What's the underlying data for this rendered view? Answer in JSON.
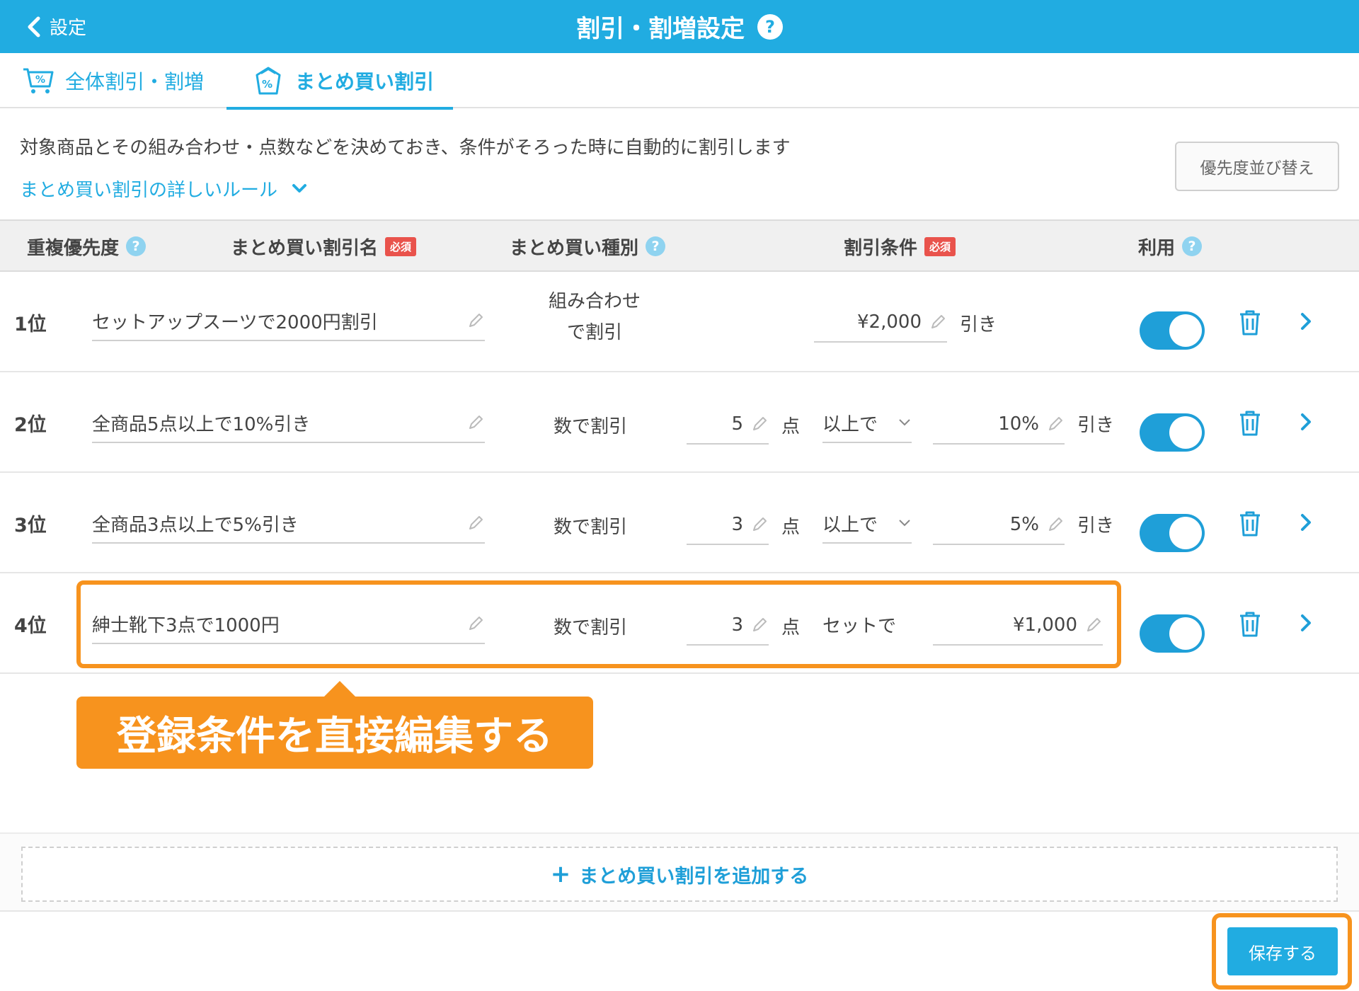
{
  "header": {
    "back_label": "設定",
    "title": "割引・割増設定",
    "help": "?"
  },
  "tabs": [
    {
      "label": "全体割引・割増"
    },
    {
      "label": "まとめ買い割引"
    }
  ],
  "description": "対象商品とその組み合わせ・点数などを決めておき、条件がそろった時に自動的に割引します",
  "rules_link": "まとめ買い割引の詳しいルール",
  "sort_button": "優先度並び替え",
  "columns": {
    "priority": "重複優先度",
    "name": "まとめ買い割引名",
    "type": "まとめ買い種別",
    "condition": "割引条件",
    "use": "利用",
    "required": "必須",
    "help": "?"
  },
  "rows": [
    {
      "rank": "1位",
      "name": "セットアップスーツで2000円割引",
      "type_line1": "組み合わせ",
      "type_line2": "で割引",
      "amount": "¥2,000",
      "suffix": "引き"
    },
    {
      "rank": "2位",
      "name": "全商品5点以上で10%引き",
      "type": "数で割引",
      "count": "5",
      "unit": "点",
      "operator": "以上で",
      "amount": "10%",
      "suffix": "引き"
    },
    {
      "rank": "3位",
      "name": "全商品3点以上で5%引き",
      "type": "数で割引",
      "count": "3",
      "unit": "点",
      "operator": "以上で",
      "amount": "5%",
      "suffix": "引き"
    },
    {
      "rank": "4位",
      "name": "紳士靴下3点で1000円",
      "type": "数で割引",
      "count": "3",
      "unit": "点",
      "operator": "セットで",
      "amount": "¥1,000"
    }
  ],
  "callout": "登録条件を直接編集する",
  "add_button": "まとめ買い割引を追加する",
  "add_plus": "+",
  "save_button": "保存する",
  "colors": {
    "accent": "#21ace1",
    "highlight": "#f7931e",
    "required": "#e9534c"
  }
}
